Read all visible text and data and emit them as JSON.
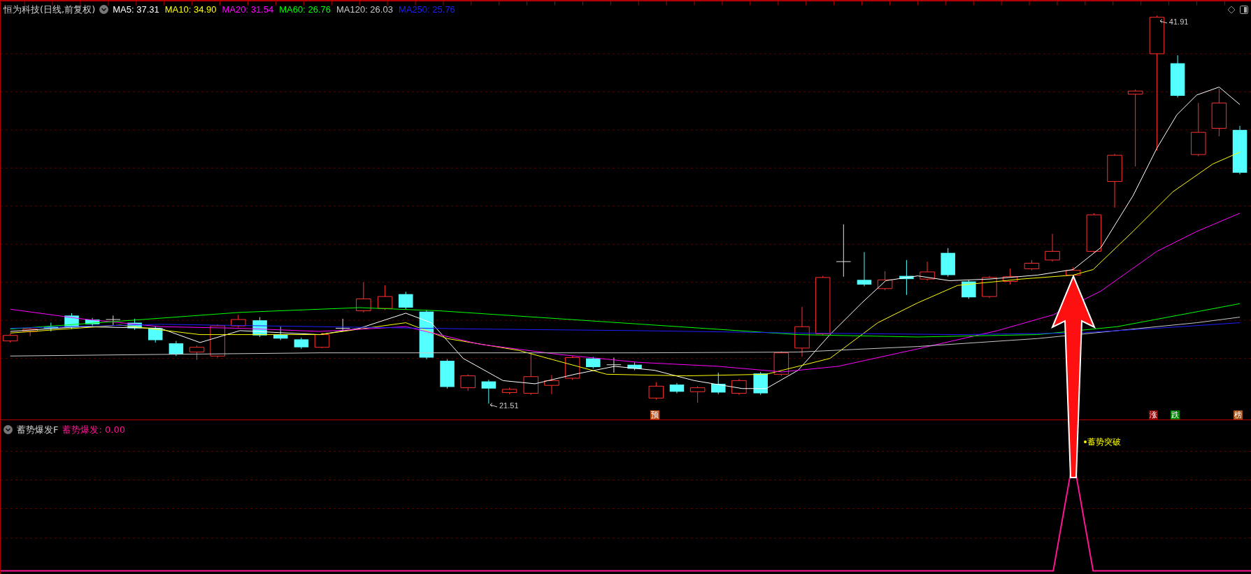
{
  "main_chart": {
    "stock_title": "恒为科技(日线,前复权)",
    "ma_legend": [
      {
        "label": "MA5: 37.31",
        "color": "#ffffff"
      },
      {
        "label": "MA10: 34.90",
        "color": "#ffff00"
      },
      {
        "label": "MA20: 31.54",
        "color": "#ff00ff"
      },
      {
        "label": "MA60: 26.76",
        "color": "#00ff00"
      },
      {
        "label": "MA120: 26.03",
        "color": "#c8c8c8"
      },
      {
        "label": "MA250: 25.76",
        "color": "#1e1eff"
      }
    ],
    "price_labels": [
      {
        "kind": "high",
        "text": "41.91"
      },
      {
        "kind": "low",
        "text": "21.51"
      }
    ],
    "signal_markers": [
      {
        "text": "预",
        "color": "#c0501a"
      },
      {
        "text": "涨",
        "color": "#8b0000"
      },
      {
        "text": "跌",
        "color": "#008000"
      },
      {
        "text": "榜",
        "color": "#a0501a"
      }
    ]
  },
  "indicator_panel": {
    "name": "蓄势爆发F",
    "value_label": "蓄势爆发: 0.00",
    "signal_text": "蓄势突破"
  }
}
